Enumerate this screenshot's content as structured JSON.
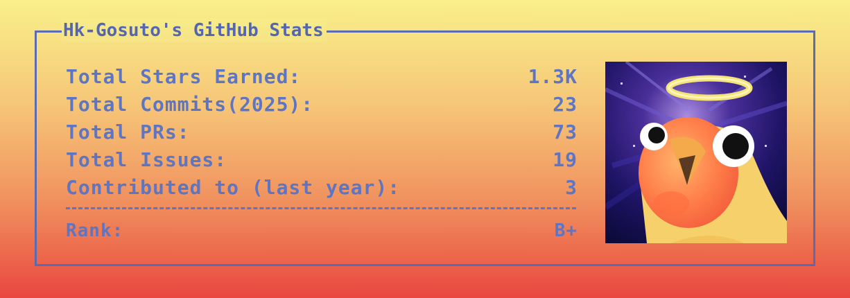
{
  "card": {
    "title": "Hk-Gosuto's GitHub Stats"
  },
  "stats": [
    {
      "label": "Total Stars Earned:",
      "value": "1.3K"
    },
    {
      "label": "Total Commits(2025):",
      "value": "23"
    },
    {
      "label": "Total PRs:",
      "value": "73"
    },
    {
      "label": "Total Issues:",
      "value": "19"
    },
    {
      "label": "Contributed to (last year):",
      "value": "3"
    }
  ],
  "rank": {
    "label": "Rank:",
    "value": "B+"
  },
  "colors": {
    "text": "#5d75c2",
    "border": "#5b6bb0",
    "gradient_top": "#f9f08a",
    "gradient_bottom": "#e9473f"
  },
  "avatar": {
    "icon": "pixel-bird-with-halo-icon"
  }
}
